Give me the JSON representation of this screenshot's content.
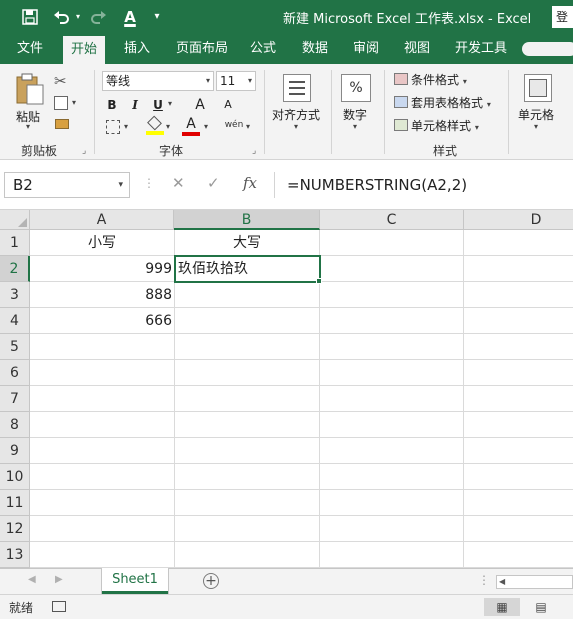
{
  "title_bar": {
    "title": "新建 Microsoft Excel 工作表.xlsx  -  Excel",
    "login": "登",
    "icons": [
      "save-icon",
      "undo-icon",
      "redo-icon",
      "font-color-icon",
      "customize-qat-icon"
    ]
  },
  "tabs": [
    {
      "label": "文件"
    },
    {
      "label": "开始"
    },
    {
      "label": "插入"
    },
    {
      "label": "页面布局"
    },
    {
      "label": "公式"
    },
    {
      "label": "数据"
    },
    {
      "label": "审阅"
    },
    {
      "label": "视图"
    },
    {
      "label": "开发工具"
    }
  ],
  "active_tab": "开始",
  "ribbon": {
    "clipboard": {
      "paste_label": "粘贴",
      "group_label": "剪贴板"
    },
    "font": {
      "font_name": "等线",
      "font_size": "11",
      "bold": "B",
      "italic": "I",
      "underline": "U",
      "grow": "A",
      "shrink": "A",
      "phonetic": "wén",
      "font_color": "A",
      "group_label": "字体"
    },
    "alignment": {
      "label": "对齐方式"
    },
    "number": {
      "label": "数字",
      "symbol": "%"
    },
    "styles": {
      "conditional": "条件格式",
      "table": "套用表格格式",
      "cell_styles": "单元格样式",
      "group_label": "样式"
    },
    "cells": {
      "label": "单元格"
    }
  },
  "formula_bar": {
    "name_box": "B2",
    "formula": "=NUMBERSTRING(A2,2)",
    "cancel": "✕",
    "enter": "✓",
    "fx": "fx"
  },
  "sheet": {
    "columns": [
      "A",
      "B",
      "C",
      "D"
    ],
    "selected_column": "B",
    "rows": [
      "1",
      "2",
      "3",
      "4",
      "5",
      "6",
      "7",
      "8",
      "9",
      "10",
      "11",
      "12",
      "13"
    ],
    "selected_row": "2",
    "cells": {
      "A1": "小写",
      "B1": "大写",
      "A2": "999",
      "B2": "玖佰玖拾玖",
      "A3": "888",
      "A4": "666"
    },
    "active_cell": "B2"
  },
  "sheet_tabs": {
    "tabs": [
      "Sheet1"
    ],
    "active": "Sheet1",
    "add": "+"
  },
  "status_bar": {
    "status": "就绪"
  },
  "colors": {
    "accent": "#217346",
    "ribbon_bg": "#f3f3f3",
    "header_bg": "#e6e6e6",
    "gridline": "#dadada"
  }
}
